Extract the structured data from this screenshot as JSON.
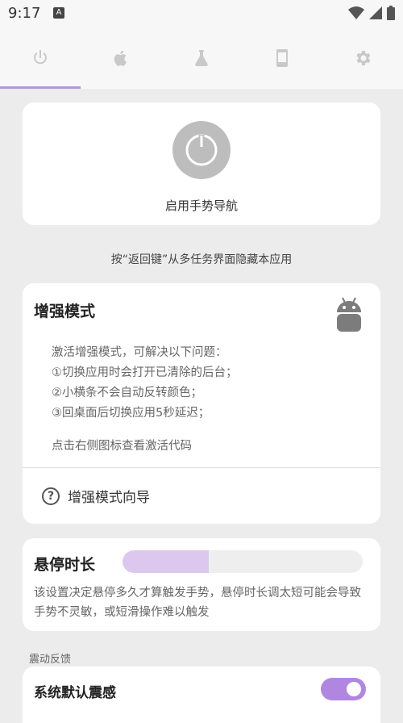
{
  "status_bar": {
    "time": "9:17",
    "notification_icon": "a-icon",
    "icons": [
      "wifi-icon",
      "signal-icon",
      "battery-icon"
    ]
  },
  "tabs": [
    {
      "icon": "power-icon",
      "selected": true
    },
    {
      "icon": "apple-icon",
      "selected": false
    },
    {
      "icon": "flask-icon",
      "selected": false
    },
    {
      "icon": "phone-icon",
      "selected": false
    },
    {
      "icon": "gear-icon",
      "selected": false
    }
  ],
  "power_card": {
    "label": "启用手势导航",
    "icon": "power-icon"
  },
  "hint_text": "按“返回键”从多任务界面隐藏本应用",
  "enhanced_mode": {
    "title": "增强模式",
    "icon": "android-icon",
    "description_lines": [
      "激活增强模式，可解决以下问题：",
      "①切换应用时会打开已清除的后台；",
      "②小横条不会自动反转颜色；",
      "③回桌面后切换应用5秒延迟；"
    ],
    "hint": "点击右侧图标查看激活代码",
    "guide_label": "增强模式向导",
    "guide_icon": "help-icon"
  },
  "hover_duration": {
    "title": "悬停时长",
    "slider_fraction": 0.36,
    "description": "该设置决定悬停多久才算触发手势，悬停时长调太短可能会导致手势不灵敏，或短滑操作难以触发"
  },
  "vibration": {
    "section_label": "震动反馈",
    "system_default_label": "系统默认震感",
    "toggle_on": true
  },
  "colors": {
    "accent": "#b494dc",
    "toggle": "#b186e1",
    "slider_fill": "#dcc7ef"
  }
}
